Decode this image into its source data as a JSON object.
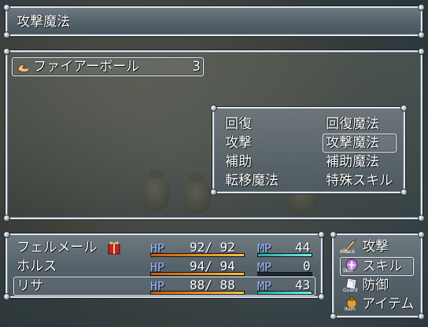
{
  "help": {
    "text": "攻撃魔法"
  },
  "item_window": {
    "name": "ファイアーボール",
    "count": "3"
  },
  "skill_types": [
    {
      "label": "回復"
    },
    {
      "label": "回復魔法"
    },
    {
      "label": "攻撃"
    },
    {
      "label": "攻撃魔法"
    },
    {
      "label": "補助"
    },
    {
      "label": "補助魔法"
    },
    {
      "label": "転移魔法"
    },
    {
      "label": "特殊スキル"
    }
  ],
  "party": [
    {
      "name": "フェルメール",
      "hp_label": "HP",
      "hp": "92",
      "hp_max": "92",
      "mp_label": "MP",
      "mp": "44",
      "hp_ratio": 1.0,
      "mp_ratio": 1.0,
      "state_icon": "gift-icon"
    },
    {
      "name": "ホルス",
      "hp_label": "HP",
      "hp": "94",
      "hp_max": "94",
      "mp_label": "MP",
      "mp": "0",
      "hp_ratio": 1.0,
      "mp_ratio": 0.0,
      "state_icon": ""
    },
    {
      "name": "リサ",
      "hp_label": "HP",
      "hp": "88",
      "hp_max": "88",
      "mp_label": "MP",
      "mp": "43",
      "hp_ratio": 1.0,
      "mp_ratio": 1.0,
      "state_icon": ""
    }
  ],
  "commands": [
    {
      "label": "攻撃",
      "icon_text": "Attack",
      "icon": "sword-icon"
    },
    {
      "label": "スキル",
      "icon_text": "Skill",
      "icon": "skill-orb-icon"
    },
    {
      "label": "防御",
      "icon_text": "Guard",
      "icon": "shield-icon"
    },
    {
      "label": "アイテム",
      "icon_text": "Item",
      "icon": "bag-icon"
    }
  ],
  "colors": {
    "hp_gauge": "#f6c040",
    "mp_gauge": "#70f0e8",
    "stat_label": "#9bb6ff"
  }
}
